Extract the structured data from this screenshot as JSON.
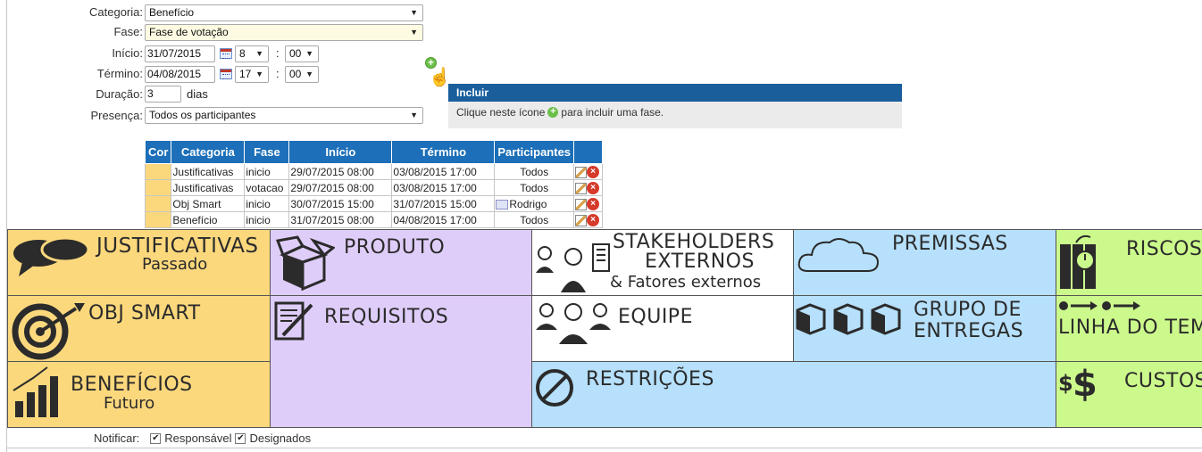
{
  "form": {
    "categoria_label": "Categoria:",
    "categoria_value": "Benefício",
    "fase_label": "Fase:",
    "fase_value": "Fase de votação",
    "inicio_label": "Início:",
    "inicio_date": "31/07/2015",
    "inicio_hour": "8",
    "inicio_min": "00",
    "termino_label": "Término:",
    "termino_date": "04/08/2015",
    "termino_hour": "17",
    "termino_min": "00",
    "duracao_label": "Duração:",
    "duracao_value": "3",
    "duracao_unit": "dias",
    "presenca_label": "Presença:",
    "presenca_value": "Todos os participantes",
    "time_sep": ":"
  },
  "tooltip": {
    "title": "Incluir",
    "text_before": "Clique neste ícone",
    "text_after": "para incluir uma fase."
  },
  "table": {
    "headers": [
      "Cor",
      "Categoria",
      "Fase",
      "Início",
      "Término",
      "Participantes",
      ""
    ],
    "rows": [
      {
        "categoria": "Justificativas",
        "fase": "inicio",
        "inicio": "29/07/2015 08:00",
        "termino": "03/08/2015 17:00",
        "participantes": "Todos"
      },
      {
        "categoria": "Justificativas",
        "fase": "votacao",
        "inicio": "29/07/2015 08:00",
        "termino": "03/08/2015 17:00",
        "participantes": "Todos"
      },
      {
        "categoria": "Obj Smart",
        "fase": "inicio",
        "inicio": "30/07/2015 15:00",
        "termino": "31/07/2015 15:00",
        "participantes": "Rodrigo"
      },
      {
        "categoria": "Benefício",
        "fase": "inicio",
        "inicio": "31/07/2015 08:00",
        "termino": "04/08/2015 17:00",
        "participantes": "Todos"
      }
    ],
    "swatch_color": "#fcd87d"
  },
  "canvas": {
    "justificativas": {
      "title": "JUSTIFICATIVAS",
      "sub": "Passado"
    },
    "obj_smart": {
      "title": "OBJ SMART"
    },
    "beneficios": {
      "title": "BENEFÍCIOS",
      "sub": "Futuro"
    },
    "produto": {
      "title": "PRODUTO"
    },
    "requisitos": {
      "title": "REQUISITOS"
    },
    "stakeholders": {
      "line1": "STAKEHOLDERS",
      "line2": "EXTERNOS",
      "line3": "& Fatores externos"
    },
    "equipe": {
      "title": "EQUIPE"
    },
    "restricoes": {
      "title": "RESTRIÇÕES"
    },
    "premissas": {
      "title": "PREMISSAS"
    },
    "grupo": {
      "line1": "GRUPO DE",
      "line2": "ENTREGAS"
    },
    "riscos": {
      "title": "RISCOS"
    },
    "linha": {
      "title": "LINHA DO TEMPO"
    },
    "custos": {
      "title": "CUSTOS"
    }
  },
  "notify": {
    "label": "Notificar:",
    "opt1": "Responsável",
    "opt2": "Designados"
  },
  "colors": {
    "yellow": "#fcd87d",
    "purple": "#dfcdf9",
    "blue": "#b6e0fb",
    "green": "#ccf98c",
    "header_blue": "#1c6fb8"
  }
}
